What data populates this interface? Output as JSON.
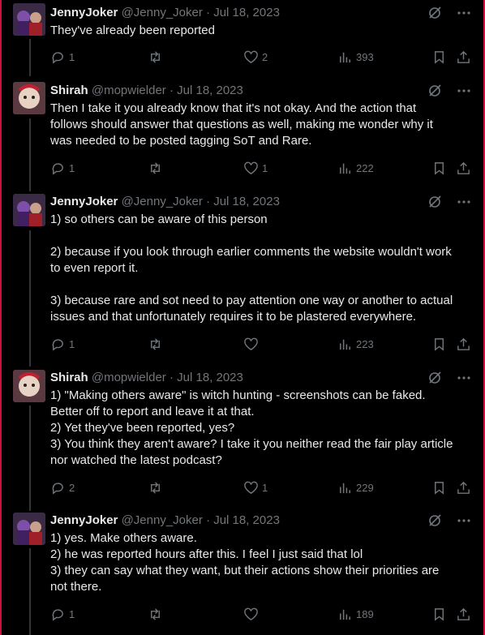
{
  "colors": {
    "background": "#000000",
    "frame": "#d0103a",
    "text": "#e7e9ea",
    "muted": "#71767b"
  },
  "tweets": [
    {
      "author": "JennyJoker",
      "handle": "@Jenny_Joker",
      "dot": "·",
      "date": "Jul 18, 2023",
      "text": "They've already been reported",
      "replies": "1",
      "retweets": "",
      "likes": "2",
      "views": "393"
    },
    {
      "author": "Shirah",
      "handle": "@mopwielder",
      "dot": "·",
      "date": "Jul 18, 2023",
      "text": "Then I take it you already know that it's not okay. And the action that\nfollows should answer that questions as well, making me wonder why it\nwas needed to be posted tagging SoT and Rare.",
      "replies": "1",
      "retweets": "",
      "likes": "1",
      "views": "222"
    },
    {
      "author": "JennyJoker",
      "handle": "@Jenny_Joker",
      "dot": "·",
      "date": "Jul 18, 2023",
      "text": "1) so others can be aware of this person\n\n2) because if you look through earlier comments the website wouldn't work\nto even report it.\n\n3) because rare and sot need to pay attention one way or another to actual\nissues and that unfortunately requires it to be plastered everywhere.",
      "replies": "1",
      "retweets": "",
      "likes": "",
      "views": "223"
    },
    {
      "author": "Shirah",
      "handle": "@mopwielder",
      "dot": "·",
      "date": "Jul 18, 2023",
      "text": "1) \"Making others aware\" is witch hunting - screenshots can be faked.\nBetter off to report and leave it at that.\n2) Yet they've been reported, yes?\n3) You think they aren't aware? I take it you neither read the fair play article\nnor watched the latest podcast?",
      "replies": "2",
      "retweets": "",
      "likes": "1",
      "views": "229"
    },
    {
      "author": "JennyJoker",
      "handle": "@Jenny_Joker",
      "dot": "·",
      "date": "Jul 18, 2023",
      "text": "1) yes. Make others aware.\n2) he was reported hours after this. I feel I just said that lol\n3) they can say what they want, but their actions show their priorities are\nnot there.",
      "replies": "1",
      "retweets": "",
      "likes": "",
      "views": "189"
    }
  ]
}
